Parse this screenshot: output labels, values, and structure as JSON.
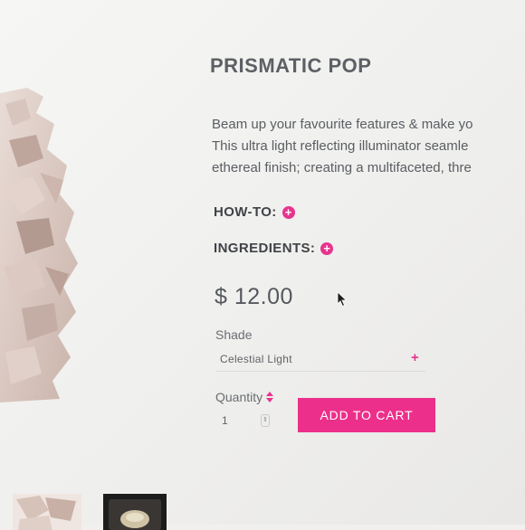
{
  "product": {
    "title": "PRISMATIC POP",
    "description_lines": [
      "Beam up your favourite features & make yo",
      "This ultra light reflecting illuminator seamle",
      "ethereal finish; creating a multifaceted, thre"
    ],
    "accordions": {
      "howto_label": "HOW-TO:",
      "ingredients_label": "INGREDIENTS:"
    },
    "price": "$ 12.00",
    "shade": {
      "label": "Shade",
      "selected": "Celestial Light"
    },
    "quantity": {
      "label": "Quantity",
      "value": "1"
    },
    "add_to_cart_label": "ADD TO CART"
  },
  "colors": {
    "accent": "#ec2f8b",
    "text": "#55585d",
    "background": "#f1f0ee"
  },
  "icons": [
    "plus-circle-icon",
    "plus-icon",
    "sort-arrows-icon",
    "mouse-cursor-icon"
  ]
}
